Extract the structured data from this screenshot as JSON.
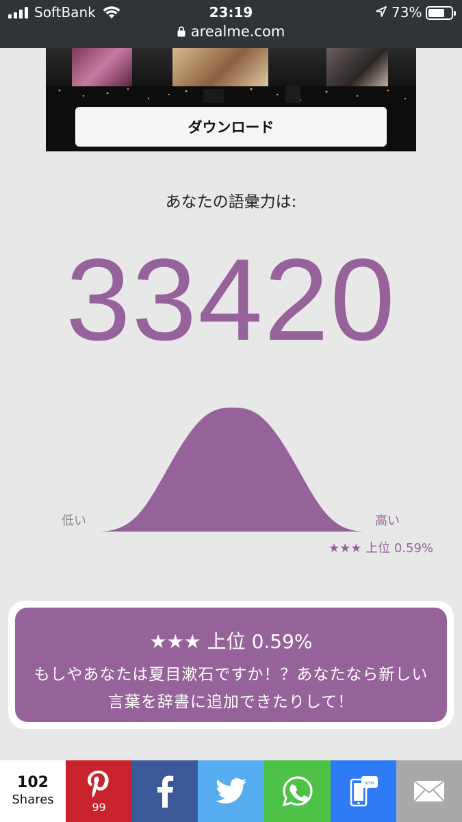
{
  "status": {
    "carrier": "SoftBank",
    "time": "23:19",
    "battery": "73%",
    "battery_level": 0.73,
    "url": "arealme.com"
  },
  "ad": {
    "download_label": "ダウンロード"
  },
  "result": {
    "prompt": "あなたの語彙力は:",
    "score": "33420",
    "low_label": "低い",
    "high_label": "高い",
    "rank_small": "★★★ 上位 0.59%",
    "rank_title": "★★★ 上位 0.59%",
    "message": "もしやあなたは夏目漱石ですか！？あなたなら新しい言葉を辞書に追加できたりして！"
  },
  "share": {
    "count": "102",
    "count_label": "Shares",
    "pinterest_count": "99"
  },
  "colors": {
    "accent": "#96629a",
    "pinterest": "#c8232c",
    "facebook": "#3b5998",
    "twitter": "#55acee",
    "whatsapp": "#4dc247",
    "sms": "#2f7bf6",
    "email": "#a9a9a9"
  }
}
